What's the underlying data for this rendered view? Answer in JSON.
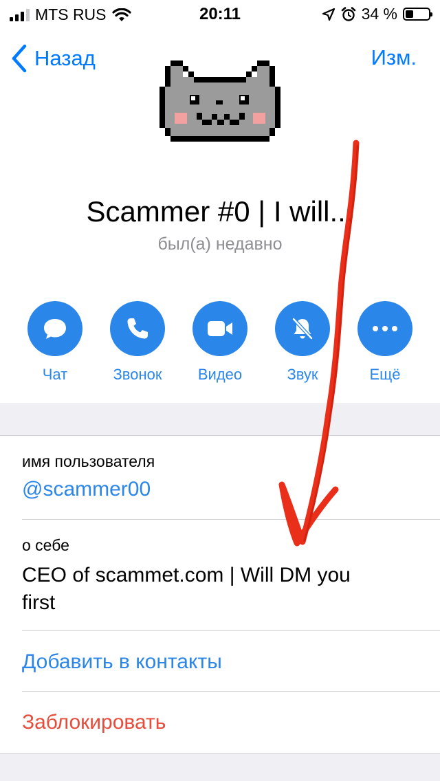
{
  "status_bar": {
    "carrier": "MTS RUS",
    "time": "20:11",
    "battery_text": "34 %",
    "battery_level": 0.34,
    "icons": [
      "signal-icon",
      "wifi-icon",
      "location-icon",
      "alarm-icon",
      "battery-icon"
    ]
  },
  "nav": {
    "back_label": "Назад",
    "edit_label": "Изм."
  },
  "profile": {
    "name": "Scammer #0 | I will...",
    "status": "был(а) недавно",
    "avatar_icon": "nyan-cat-icon"
  },
  "actions": [
    {
      "label": "Чат",
      "icon": "chat-icon"
    },
    {
      "label": "Звонок",
      "icon": "phone-icon"
    },
    {
      "label": "Видео",
      "icon": "video-icon"
    },
    {
      "label": "Звук",
      "icon": "bell-muted-icon"
    },
    {
      "label": "Ещё",
      "icon": "more-icon"
    }
  ],
  "info": {
    "username_caption": "имя пользователя",
    "username": "@scammer00",
    "bio_caption": "о себе",
    "bio_line1": "CEO of scammet.com | Will DM you",
    "bio_line2": "first",
    "add_contact": "Добавить в контакты",
    "block": "Заблокировать"
  },
  "colors": {
    "accent": "#2a86e8",
    "destructive": "#e64c3c",
    "annotation": "#e8230e"
  }
}
